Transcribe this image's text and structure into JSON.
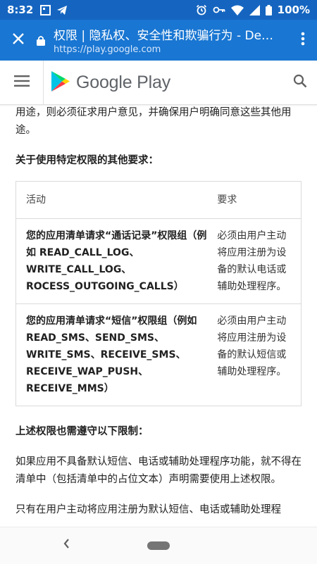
{
  "status_bar": {
    "time": "8:32",
    "battery": "100%",
    "icons": [
      "square-notification-icon",
      "telegram-icon",
      "alarm-icon",
      "vpn-key-icon",
      "wifi-icon",
      "signal-icon",
      "battery-icon"
    ]
  },
  "browser": {
    "title": "权限 | 隐私权、安全性和欺骗行为 - De…",
    "url": "https://play.google.com",
    "colors": {
      "toolbar": "#1976d2",
      "status": "#1565c0"
    }
  },
  "header": {
    "logo_text": "Google Play"
  },
  "content": {
    "para1": "用途，则必须征求用户意见，并确保用户明确同意这些其他用途。",
    "heading_requirements": "关于使用特定权限的其他要求：",
    "table": {
      "headers": [
        "活动",
        "要求"
      ],
      "rows": [
        {
          "activity": "您的应用清单请求“通话记录”权限组（例如 READ_CALL_LOG、WRITE_CALL_LOG、ROCESS_OUTGOING_CALLS）",
          "requirement": "必须由用户主动将应用注册为设备的默认电话或辅助处理程序。"
        },
        {
          "activity": "您的应用清单请求“短信”权限组（例如 READ_SMS、SEND_SMS、WRITE_SMS、RECEIVE_SMS、RECEIVE_WAP_PUSH、RECEIVE_MMS）",
          "requirement": "必须由用户主动将应用注册为设备的默认短信或辅助处理程序。"
        }
      ]
    },
    "heading_limits": "上述权限也需遵守以下限制：",
    "para2": "如果应用不具备默认短信、电话或辅助处理程序功能，就不得在清单中（包括清单中的占位文本）声明需要使用上述权限。",
    "para3": "只有在用户主动将应用注册为默认短信、电话或辅助处理程"
  }
}
